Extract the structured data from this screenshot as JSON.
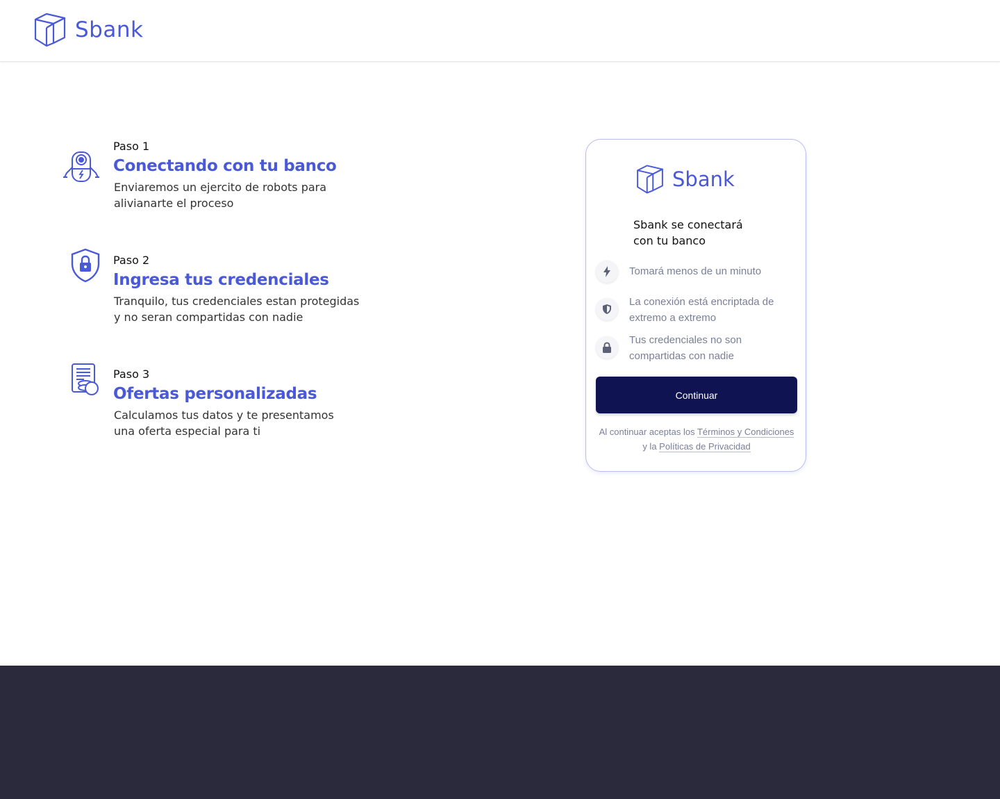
{
  "header": {
    "brand_name": "Sbank"
  },
  "steps": [
    {
      "label": "Paso 1",
      "title": "Conectando con tu banco",
      "desc_line1": "Enviaremos un ejercito de robots para",
      "desc_line2": "alivianarte el proceso",
      "icon": "robot-icon"
    },
    {
      "label": "Paso 2",
      "title": "Ingresa tus credenciales",
      "desc_line1": "Tranquilo, tus credenciales estan protegidas",
      "desc_line2": "y no seran compartidas con nadie",
      "icon": "shield-lock-icon"
    },
    {
      "label": "Paso 3",
      "title": "Ofertas personalizadas",
      "desc_line1": "Calculamos tus datos y te presentamos",
      "desc_line2": "una oferta especial para ti",
      "icon": "document-coins-icon"
    }
  ],
  "card": {
    "brand_name": "Sbank",
    "heading_line1": "Sbank se conectará",
    "heading_line2": "con tu banco",
    "features": [
      {
        "icon": "lightning-icon",
        "text": "Tomará menos de un minuto"
      },
      {
        "icon": "shield-icon",
        "text": "La conexión está encriptada de extremo a extremo"
      },
      {
        "icon": "lock-icon",
        "text": "Tus credenciales no son compartidas con nadie"
      }
    ],
    "continue_label": "Continuar",
    "legal_prefix": "Al continuar aceptas los",
    "legal_terms": "Términos y Condiciones",
    "legal_middle": "y la",
    "legal_privacy": "Políticas de Privacidad"
  },
  "colors": {
    "brand": "#4a59d8",
    "button": "#0f1352",
    "footer": "#2b293c",
    "muted": "#7a7f98"
  }
}
